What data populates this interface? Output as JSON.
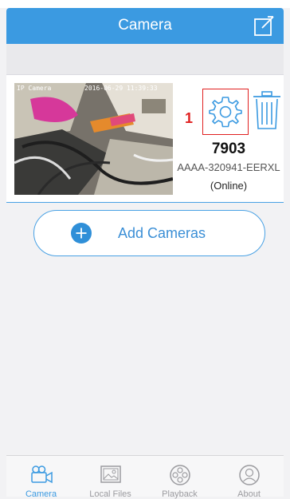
{
  "header": {
    "title": "Camera"
  },
  "camera": {
    "overlay_name": "IP Camera",
    "overlay_timestamp": "2016-06-29 11:39:33",
    "marker": "1",
    "name": "7903",
    "id": "AAAA-320941-EERXL",
    "status": "(Online)"
  },
  "add_button": {
    "label": "Add Cameras"
  },
  "tabs": [
    {
      "label": "Camera",
      "icon": "camera-icon",
      "active": true
    },
    {
      "label": "Local Files",
      "icon": "image-icon",
      "active": false
    },
    {
      "label": "Playback",
      "icon": "film-reel-icon",
      "active": false
    },
    {
      "label": "About",
      "icon": "user-icon",
      "active": false
    }
  ],
  "colors": {
    "accent": "#3b9ae1",
    "highlight": "#e02020"
  }
}
